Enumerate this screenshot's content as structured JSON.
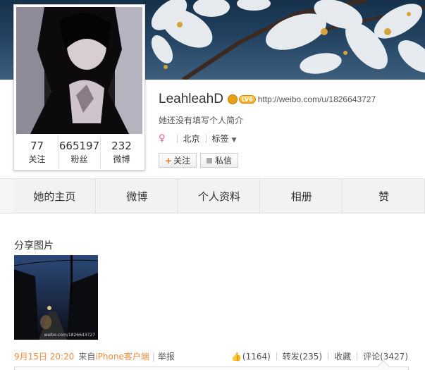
{
  "profile": {
    "username": "LeahleahD",
    "level_badge": "LV6",
    "profile_url": "http://weibo.com/u/1826643727",
    "bio": "她还没有填写个人简介",
    "location": "北京",
    "tags_label": "标签",
    "follow_button": "关注",
    "message_button": "私信",
    "stats": [
      {
        "value": "77",
        "label": "关注"
      },
      {
        "value": "665197",
        "label": "粉丝"
      },
      {
        "value": "232",
        "label": "微博"
      }
    ]
  },
  "nav": {
    "tabs": [
      "她的主页",
      "微博",
      "个人资料",
      "相册",
      "赞"
    ]
  },
  "post": {
    "title": "分享图片",
    "image_watermark": "weibo.com/1826643727",
    "time": "9月15日 20:20",
    "source_prefix": "来自",
    "source": "iPhone客户端",
    "report": "举报",
    "likes": "(1164)",
    "repost": "转发(235)",
    "favorite": "收藏",
    "comment": "评论(3427)"
  },
  "colors": {
    "accent_orange": "#f28c3a",
    "like_blue": "#3f8bd4",
    "female_pink": "#e05c9e"
  }
}
